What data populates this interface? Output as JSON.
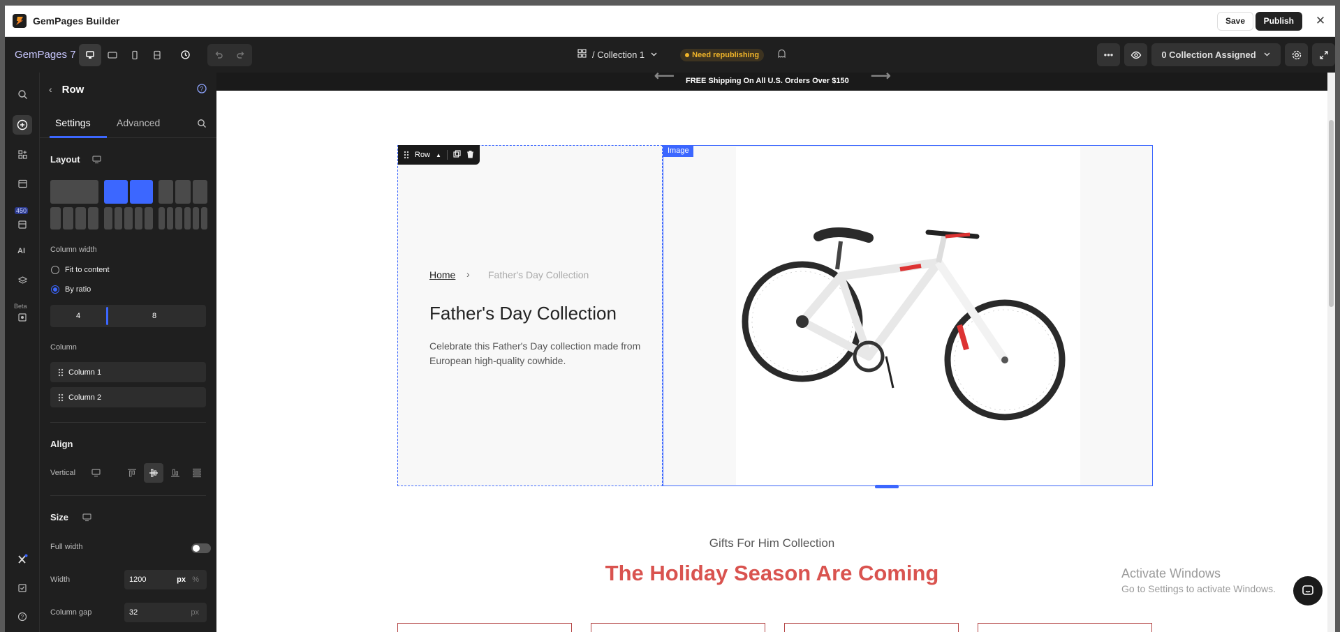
{
  "window": {
    "title": "GemPages Builder",
    "save_label": "Save",
    "publish_label": "Publish"
  },
  "toolbar": {
    "brand": "GemPages 7",
    "page_name": "/ Collection 1",
    "status_badge": "Need republishing",
    "assign_label": "0 Collection Assigned"
  },
  "sidebar_icons": {
    "count_badge": "450",
    "beta_label": "Beta"
  },
  "panel": {
    "title": "Row",
    "tabs": [
      "Settings",
      "Advanced"
    ],
    "layout_title": "Layout",
    "column_width_label": "Column width",
    "options": [
      "Fit to content",
      "By ratio"
    ],
    "ratio_left": "4",
    "ratio_right": "8",
    "column_label": "Column",
    "columns": [
      "Column 1",
      "Column 2"
    ],
    "align_title": "Align",
    "vertical_label": "Vertical",
    "size_title": "Size",
    "full_width_label": "Full width",
    "width_label": "Width",
    "width_value": "1200",
    "width_unit_px": "px",
    "width_unit_pct": "%",
    "gap_label": "Column gap",
    "gap_value": "32",
    "gap_unit": "px"
  },
  "canvas": {
    "announcement": "FREE Shipping On All U.S. Orders Over $150",
    "row_tag": "Row",
    "image_tag": "Image",
    "breadcrumb_home": "Home",
    "breadcrumb_current": "Father's Day Collection",
    "hero_title": "Father's Day Collection",
    "hero_desc": "Celebrate this Father's Day collection made from European high-quality cowhide.",
    "section_subtitle": "Gifts For Him Collection",
    "section_title": "The Holiday Season Are Coming"
  },
  "os": {
    "watermark_title": "Activate Windows",
    "watermark_sub": "Go to Settings to activate Windows."
  },
  "colors": {
    "accent": "#3c67ff",
    "title_red": "#d9534f",
    "dark": "#1f1f1f",
    "warning": "#f0b429"
  }
}
